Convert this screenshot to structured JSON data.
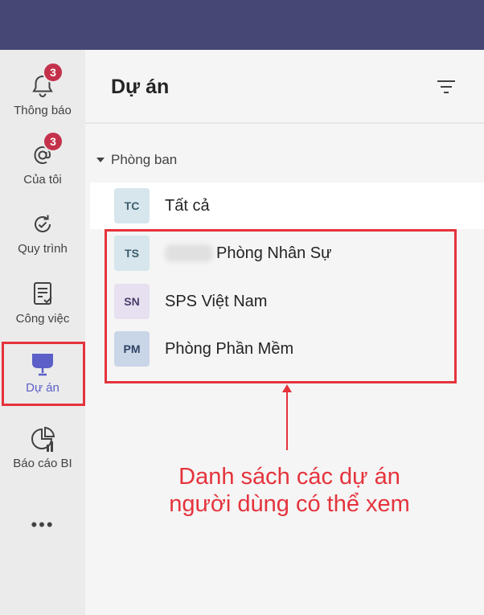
{
  "rail": {
    "items": [
      {
        "label": "Thông báo",
        "icon": "bell-icon",
        "badge": "3"
      },
      {
        "label": "Của tôi",
        "icon": "at-mention-icon",
        "badge": "3"
      },
      {
        "label": "Quy trình",
        "icon": "process-refresh-icon"
      },
      {
        "label": "Công việc",
        "icon": "task-list-icon"
      },
      {
        "label": "Dự án",
        "icon": "project-board-icon",
        "active": true
      },
      {
        "label": "Báo cáo BI",
        "icon": "pie-chart-icon"
      }
    ],
    "more": "•••"
  },
  "panel": {
    "title": "Dự án",
    "group": "Phòng ban",
    "items": [
      {
        "initials": "TC",
        "name": "Tất cả",
        "avatar_bg": "#d6e6ec",
        "avatar_fg": "#3c5d6d",
        "selected": true
      },
      {
        "initials": "TS",
        "name": "Phòng Nhân Sự",
        "avatar_bg": "#d6e6ec",
        "avatar_fg": "#3c5d6d",
        "redacted_prefix": true
      },
      {
        "initials": "SN",
        "name": "SPS Việt Nam",
        "avatar_bg": "#e7e0f0",
        "avatar_fg": "#4b3c6b"
      },
      {
        "initials": "PM",
        "name": "Phòng Phần Mềm",
        "avatar_bg": "#c9d6e8",
        "avatar_fg": "#2f4464"
      }
    ]
  },
  "annotation": {
    "line1": "Danh sách các dự án",
    "line2": "người dùng có thể xem"
  },
  "colors": {
    "topbar": "#464775",
    "accent": "#5b5fc7",
    "badge": "#c4314b",
    "annotation_red": "#e5333c"
  }
}
